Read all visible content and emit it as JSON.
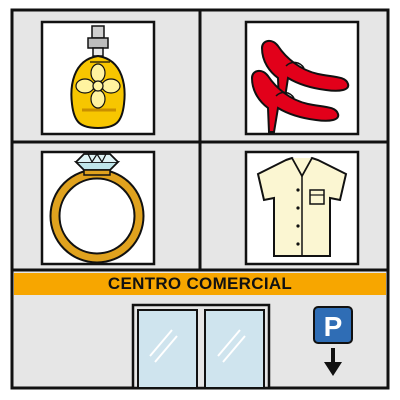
{
  "sign": {
    "label": "CENTRO COMERCIAL"
  },
  "parking": {
    "letter": "P"
  },
  "shops": [
    {
      "icon": "perfume-bottle-icon"
    },
    {
      "icon": "high-heel-shoes-icon"
    },
    {
      "icon": "diamond-ring-icon"
    },
    {
      "icon": "shirt-icon"
    }
  ],
  "colors": {
    "wall": "#e6e6e6",
    "outline": "#111111",
    "sign_band": "#f7a600",
    "window_bg": "#ffffff",
    "glass": "#cfe4ee",
    "parking_blue": "#2f6db5",
    "perfume_gold": "#f7c600",
    "shoe_red": "#e2001a",
    "ring_gold": "#e0a21e",
    "shirt_cream": "#fbf6d2"
  }
}
